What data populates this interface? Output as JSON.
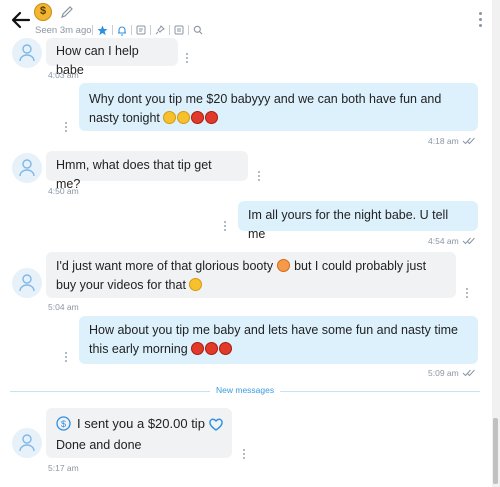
{
  "header": {
    "avatar_label": "$",
    "status": "Seen 3m ago",
    "icons": [
      "back-arrow-icon",
      "pencil-icon",
      "star-icon",
      "bell-icon",
      "note-icon",
      "pin-icon",
      "media-icon",
      "search-icon",
      "kebab-icon"
    ]
  },
  "divider": {
    "label": "New messages"
  },
  "messages": [
    {
      "dir": "in",
      "text": "How can I help babe",
      "time": "4:03 am"
    },
    {
      "dir": "out",
      "text": "Why dont you tip me $20 babyyy and we can both have fun and nasty tonight",
      "emoji": [
        "smile",
        "smile",
        "devil",
        "devil"
      ],
      "time": "4:18 am"
    },
    {
      "dir": "in",
      "text": "Hmm, what does that tip get me?",
      "time": "4:50 am"
    },
    {
      "dir": "out",
      "text": "Im all yours for the night babe. U tell me",
      "time": "4:54 am"
    },
    {
      "dir": "in",
      "text": "I'd just want more of that glorious booty",
      "text2": "but I could probably just buy your videos for that",
      "emoji": [
        "peach",
        "laugh"
      ],
      "time": "5:04 am"
    },
    {
      "dir": "out",
      "text": "How about you tip me baby and lets have some fun and nasty time this early morning",
      "emoji": [
        "devil",
        "devil",
        "devil"
      ],
      "time": "5:09 am"
    },
    {
      "dir": "in",
      "tip_label": "I sent you a $20.00 tip",
      "text": "Done and done",
      "time": "5:17 am"
    }
  ],
  "colors": {
    "accent": "#2f8fe0",
    "bubble_in": "#f0f2f4",
    "bubble_out": "#ddf1fd",
    "muted": "#8a96a3"
  }
}
